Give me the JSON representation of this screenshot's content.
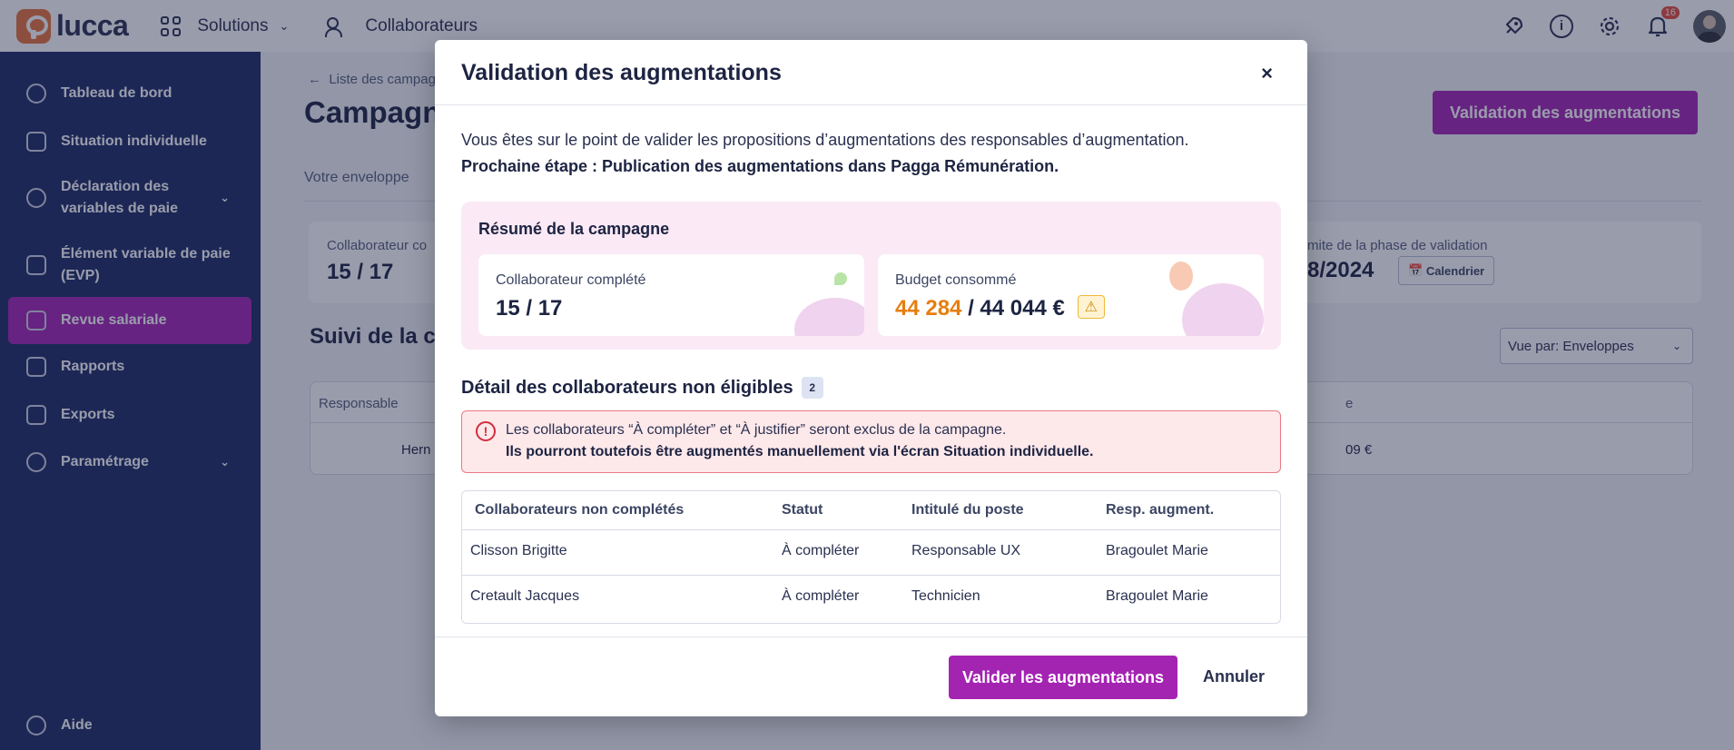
{
  "topbar": {
    "logo_text": "lucca",
    "solutions_label": "Solutions",
    "collaborateurs_label": "Collaborateurs",
    "notification_count": "16",
    "icons": [
      "rocket-icon",
      "info-icon",
      "gear-icon",
      "bell-icon"
    ]
  },
  "sidebar": {
    "items": [
      {
        "label": "Tableau de bord",
        "icon": "dashboard-icon"
      },
      {
        "label": "Situation individuelle",
        "icon": "situation-icon"
      },
      {
        "label": "Déclaration des variables de paie",
        "icon": "declaration-icon"
      },
      {
        "label": "Élément variable de paie (EVP)",
        "icon": "wallet-icon"
      },
      {
        "label": "Revue salariale",
        "icon": "clipboard-icon"
      },
      {
        "label": "Rapports",
        "icon": "chart-icon"
      },
      {
        "label": "Exports",
        "icon": "export-icon"
      },
      {
        "label": "Paramétrage",
        "icon": "settings-tools-icon"
      }
    ],
    "help_label": "Aide",
    "active_index": 4
  },
  "background": {
    "breadcrumb": "Liste des campag",
    "title": "Campagne",
    "primary_button": "Validation des augmentations",
    "tab": "Votre enveloppe",
    "left_label": "Collaborateur co",
    "left_value": "15 / 17",
    "right_label": "mite de la phase de validation",
    "right_value": "8/2024",
    "calendar_button": "Calendrier",
    "suivi_title": "Suivi de la c",
    "vue_select": "Vue par: Enveloppes",
    "table_header_left": "Responsable",
    "table_header_right": "e",
    "row_name": "Hern",
    "row_value": "09 €"
  },
  "modal": {
    "title": "Validation des augmentations",
    "close_label": "×",
    "intro_line": "Vous êtes sur le point de valider les propositions d’augmentations des responsables d’augmentation.",
    "next_step": "Prochaine étape : Publication des augmentations dans Pagga Rémunération.",
    "resume": {
      "title": "Résumé de la campagne",
      "card1_label": "Collaborateur complété",
      "card1_value": "15 / 17",
      "card2_label": "Budget consommé",
      "card2_used": "44 284",
      "card2_total": " / 44 044 €"
    },
    "detail": {
      "title": "Détail des collaborateurs non éligibles",
      "count": "2"
    },
    "alert": {
      "line1": "Les collaborateurs “À compléter” et “À justifier” seront exclus de la campagne.",
      "line2": "Ils pourront toutefois être augmentés manuellement via l'écran Situation individuelle."
    },
    "table": {
      "headers": [
        "Collaborateurs non complétés",
        "Statut",
        "Intitulé du poste",
        "Resp. augment."
      ],
      "rows": [
        [
          "Clisson Brigitte",
          "À compléter",
          "Responsable UX",
          "Bragoulet Marie"
        ],
        [
          "Cretault Jacques",
          "À compléter",
          "Technicien",
          "Bragoulet Marie"
        ]
      ]
    },
    "footer": {
      "confirm_label": "Valider les augmentations",
      "cancel_label": "Annuler"
    }
  },
  "colors": {
    "brand": "#a424b2",
    "sidebar": "#1c2a63",
    "over_budget": "#e67e0f",
    "alert_border": "#e77b84"
  }
}
